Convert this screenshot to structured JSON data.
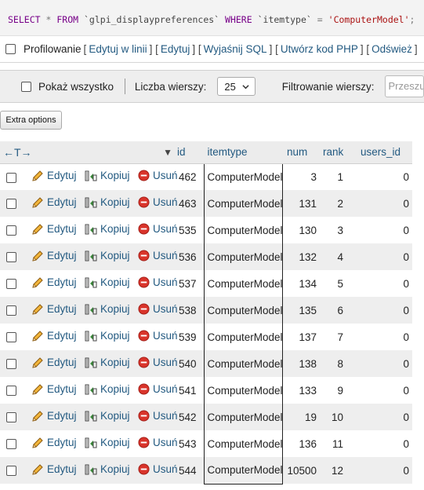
{
  "sql": {
    "select_kw": "SELECT",
    "star": "*",
    "from_kw": "FROM",
    "table": "`glpi_displaypreferences`",
    "where_kw": "WHERE",
    "column": "`itemtype`",
    "eq": "=",
    "value": "'ComputerModel'",
    "semicolon": ";"
  },
  "profile": {
    "label": "Profilowanie",
    "links": [
      "Edytuj w linii",
      "Edytuj",
      "Wyjaśnij SQL",
      "Utwórz kod PHP",
      "Odśwież"
    ]
  },
  "nav": {
    "show_all": "Pokaż wszystko",
    "rows_label": "Liczba wierszy:",
    "rows_value": "25",
    "filter_label": "Filtrowanie wierszy:",
    "filter_placeholder": "Przeszukaj"
  },
  "extra_options": "Extra options",
  "table": {
    "arrows": "←T→",
    "sort_indicator": "▼",
    "columns": [
      "id",
      "itemtype",
      "num",
      "rank",
      "users_id"
    ],
    "actions": {
      "edit": "Edytuj",
      "copy": "Kopiuj",
      "delete": "Usuń"
    },
    "rows": [
      {
        "id": "462",
        "itemtype": "ComputerModel",
        "num": "3",
        "rank": "1",
        "users_id": "0"
      },
      {
        "id": "463",
        "itemtype": "ComputerModel",
        "num": "131",
        "rank": "2",
        "users_id": "0"
      },
      {
        "id": "535",
        "itemtype": "ComputerModel",
        "num": "130",
        "rank": "3",
        "users_id": "0"
      },
      {
        "id": "536",
        "itemtype": "ComputerModel",
        "num": "132",
        "rank": "4",
        "users_id": "0"
      },
      {
        "id": "537",
        "itemtype": "ComputerModel",
        "num": "134",
        "rank": "5",
        "users_id": "0"
      },
      {
        "id": "538",
        "itemtype": "ComputerModel",
        "num": "135",
        "rank": "6",
        "users_id": "0"
      },
      {
        "id": "539",
        "itemtype": "ComputerModel",
        "num": "137",
        "rank": "7",
        "users_id": "0"
      },
      {
        "id": "540",
        "itemtype": "ComputerModel",
        "num": "138",
        "rank": "8",
        "users_id": "0"
      },
      {
        "id": "541",
        "itemtype": "ComputerModel",
        "num": "133",
        "rank": "9",
        "users_id": "0"
      },
      {
        "id": "542",
        "itemtype": "ComputerModel",
        "num": "19",
        "rank": "10",
        "users_id": "0"
      },
      {
        "id": "543",
        "itemtype": "ComputerModel",
        "num": "136",
        "rank": "11",
        "users_id": "0"
      },
      {
        "id": "544",
        "itemtype": "ComputerModel",
        "num": "10500",
        "rank": "12",
        "users_id": "0"
      }
    ]
  },
  "icons": {
    "edit": "pencil-icon",
    "copy": "copy-icon",
    "delete": "delete-icon"
  },
  "colors": {
    "link": "#235a81",
    "sql_keyword": "#770088",
    "sql_string": "#aa1111",
    "delete_red": "#d9342b"
  }
}
